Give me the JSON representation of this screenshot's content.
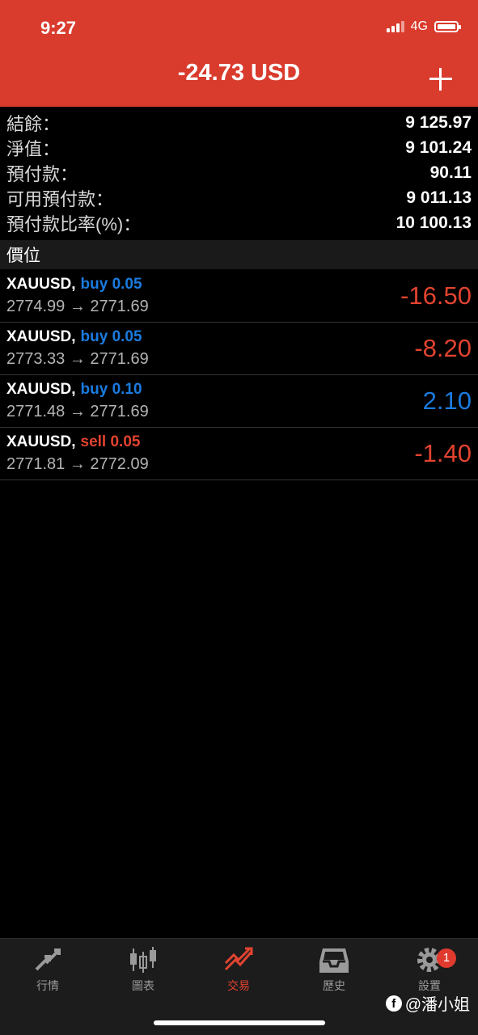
{
  "status_bar": {
    "time": "9:27",
    "network": "4G"
  },
  "header": {
    "title": "-24.73 USD"
  },
  "summary": [
    {
      "label": "結餘：",
      "value": "9 125.97"
    },
    {
      "label": "淨值：",
      "value": "9 101.24"
    },
    {
      "label": "預付款：",
      "value": "90.11"
    },
    {
      "label": "可用預付款：",
      "value": "9 011.13"
    },
    {
      "label": "預付款比率(%)：",
      "value": "10 100.13"
    }
  ],
  "positions_header": "價位",
  "positions": [
    {
      "symbol": "XAUUSD,",
      "type": "buy 0.05",
      "type_color": "#1a7be0",
      "prices": "2774.99 → 2771.69",
      "profit": "-16.50",
      "profit_color": "#e2432f"
    },
    {
      "symbol": "XAUUSD,",
      "type": "buy 0.05",
      "type_color": "#1a7be0",
      "prices": "2773.33 → 2771.69",
      "profit": "-8.20",
      "profit_color": "#e2432f"
    },
    {
      "symbol": "XAUUSD,",
      "type": "buy 0.10",
      "type_color": "#1a7be0",
      "prices": "2771.48 → 2771.69",
      "profit": "2.10",
      "profit_color": "#1a7be0"
    },
    {
      "symbol": "XAUUSD,",
      "type": "sell 0.05",
      "type_color": "#e2432f",
      "prices": "2771.81 → 2772.09",
      "profit": "-1.40",
      "profit_color": "#e2432f"
    }
  ],
  "tabs": [
    {
      "label": "行情",
      "icon": "quotes-arrows-icon",
      "active": false
    },
    {
      "label": "圖表",
      "icon": "candlestick-chart-icon",
      "active": false
    },
    {
      "label": "交易",
      "icon": "trade-trend-icon",
      "active": true
    },
    {
      "label": "歷史",
      "icon": "inbox-history-icon",
      "active": false
    },
    {
      "label": "設置",
      "icon": "gear-icon",
      "active": false,
      "badge": "1"
    }
  ],
  "colors": {
    "header_bg": "#d93b2d",
    "active_tab": "#e2432f",
    "inactive_tab": "#9a9a9a"
  },
  "watermark": "@潘小姐"
}
